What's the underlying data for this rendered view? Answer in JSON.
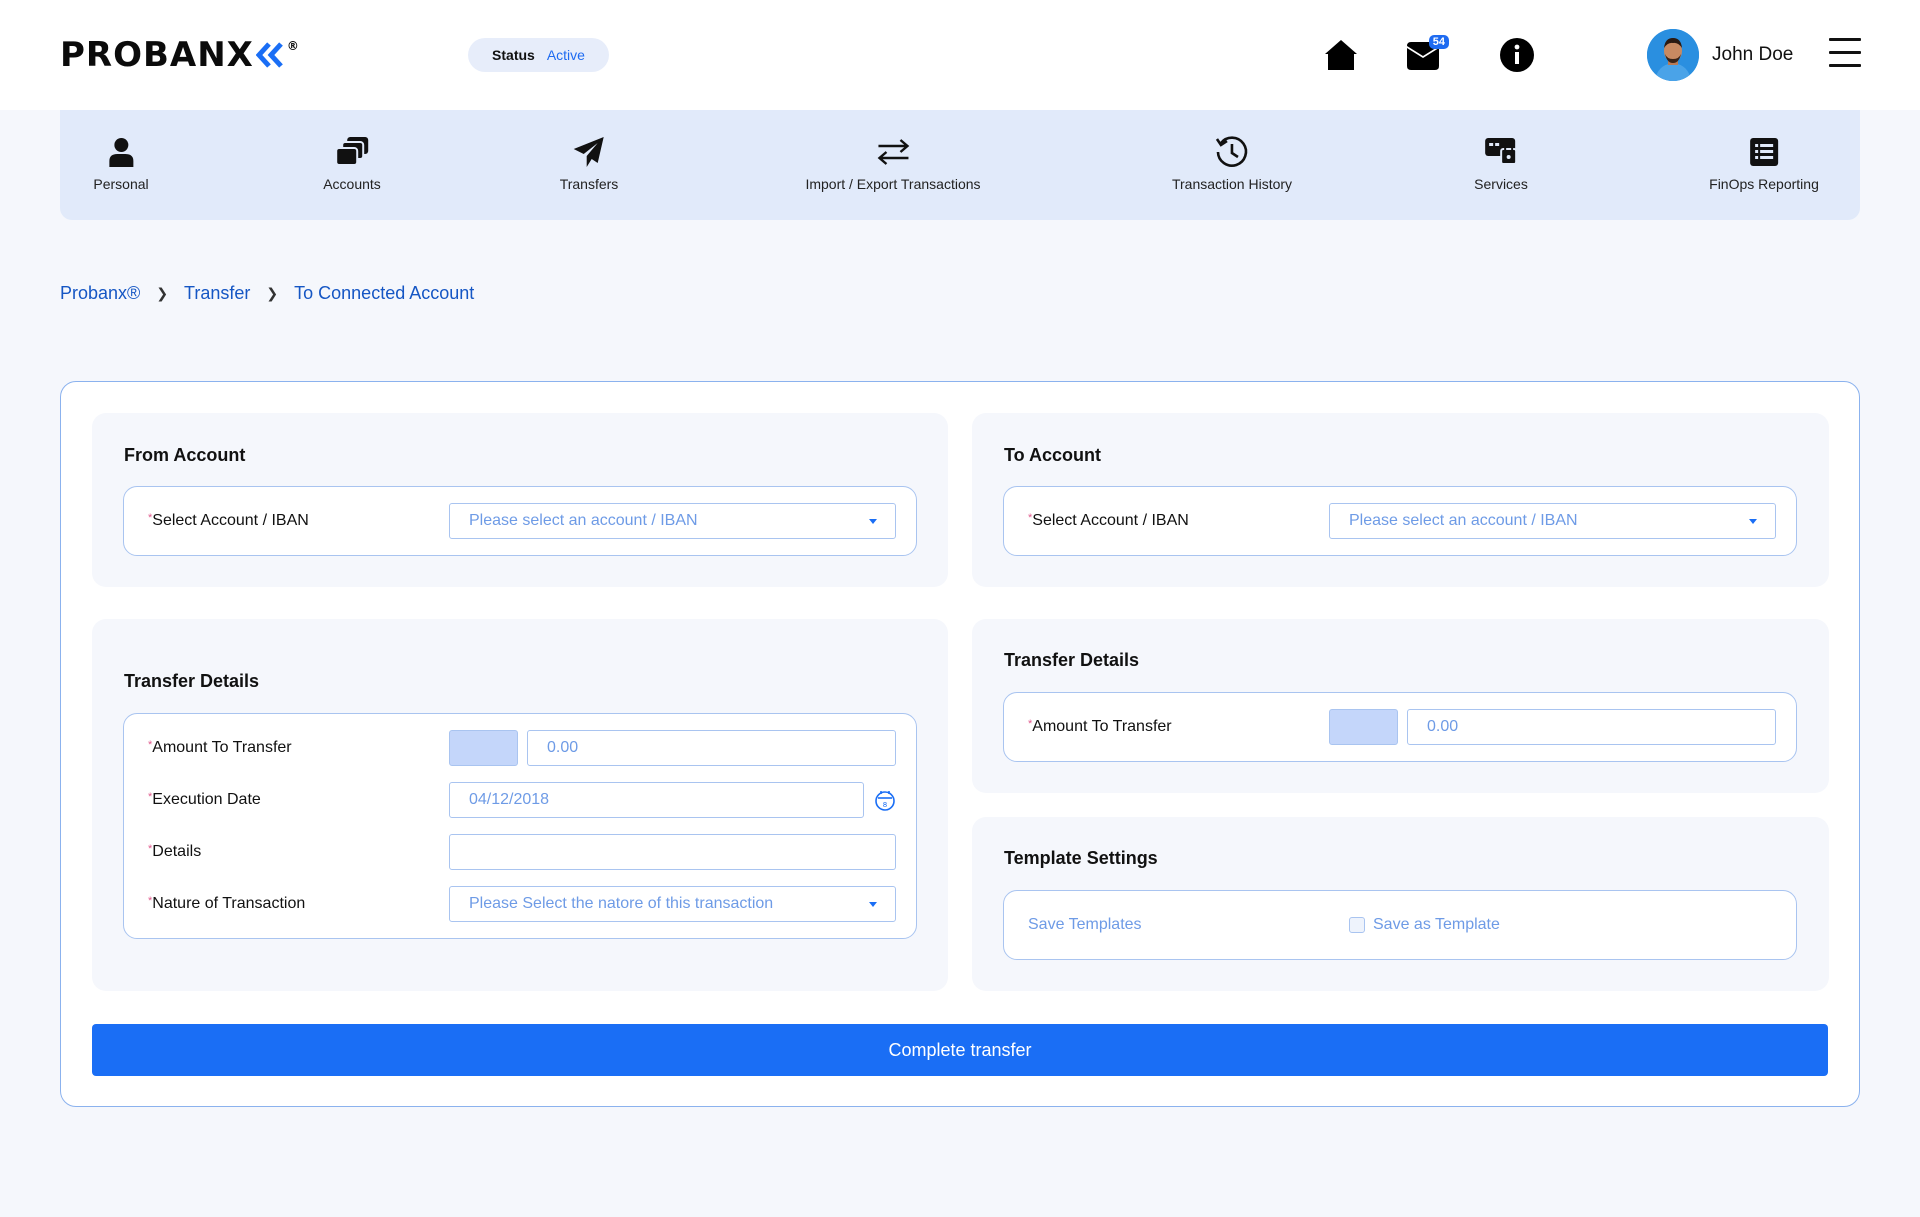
{
  "header": {
    "logo_text": "PROBANX",
    "logo_reg": "®",
    "status_label": "Status",
    "status_value": "Active",
    "mail_badge": "54",
    "user_name": "John Doe"
  },
  "nav": {
    "items": [
      {
        "label": "Personal",
        "icon": "user-icon"
      },
      {
        "label": "Accounts",
        "icon": "accounts-icon"
      },
      {
        "label": "Transfers",
        "icon": "paper-plane-icon"
      },
      {
        "label": "Import / Export Transactions",
        "icon": "swap-arrows-icon"
      },
      {
        "label": "Transaction History",
        "icon": "history-icon"
      },
      {
        "label": "Services",
        "icon": "services-lock-icon"
      },
      {
        "label": "FinOps Reporting",
        "icon": "report-list-icon"
      }
    ]
  },
  "breadcrumb": {
    "items": [
      "Probanx®",
      "Transfer",
      "To Connected Account"
    ]
  },
  "from_account": {
    "title": "From Account",
    "label": "Select Account / IBAN",
    "placeholder": "Please select an account / IBAN"
  },
  "to_account": {
    "title": "To Account",
    "label": "Select Account / IBAN",
    "placeholder": "Please select an account / IBAN"
  },
  "transfer_left": {
    "title": "Transfer Details",
    "amount_label": "Amount To Transfer",
    "amount_value": "0.00",
    "date_label": "Execution Date",
    "date_value": "04/12/2018",
    "details_label": "Details",
    "details_value": "",
    "nature_label": "Nature of Transaction",
    "nature_placeholder": "Please Select the natore of this transaction"
  },
  "transfer_right": {
    "title": "Transfer Details",
    "amount_label": "Amount To Transfer",
    "amount_value": "0.00"
  },
  "template": {
    "title": "Template Settings",
    "save_templates": "Save Templates",
    "save_as_template": "Save as Template"
  },
  "actions": {
    "complete_label": "Complete transfer"
  },
  "colors": {
    "accent": "#1a6ef5",
    "nav_bg": "#e1eafa",
    "page_bg": "#f5f7fc",
    "required_mark": "#e05a8c"
  }
}
